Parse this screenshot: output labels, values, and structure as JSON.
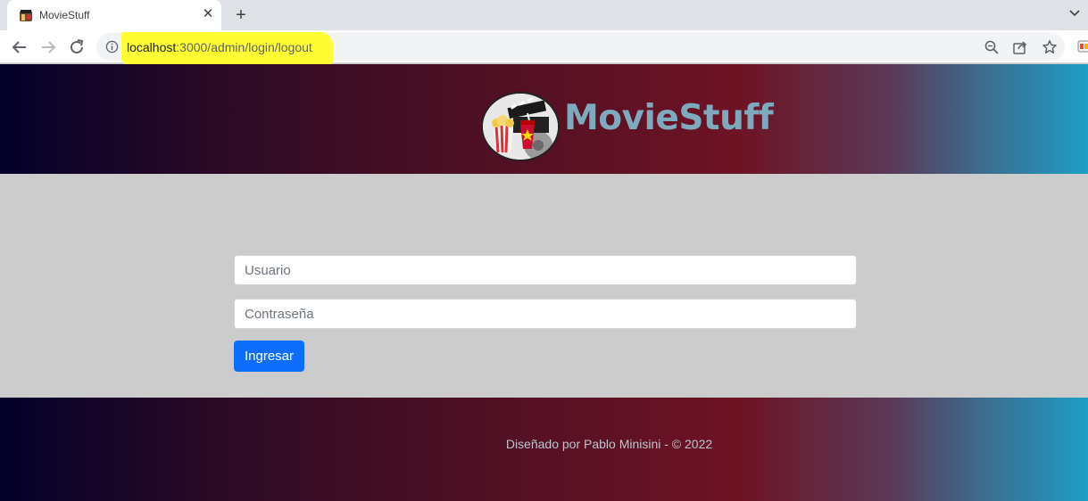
{
  "browser": {
    "tab": {
      "title": "MovieStuff",
      "close": "✕"
    },
    "new_tab": "+",
    "address": {
      "host": "localhost",
      "path": ":3000/admin/login/logout"
    }
  },
  "header": {
    "brand": "MovieStuff"
  },
  "login": {
    "username_placeholder": "Usuario",
    "password_placeholder": "Contraseña",
    "submit_label": "Ingresar"
  },
  "footer": {
    "credit": "Diseñado por Pablo Minisini - © 2022"
  },
  "colors": {
    "primary_button": "#0d6efd",
    "brand_text": "#7fa9bc",
    "page_bg": "#cccccc",
    "url_highlight": "#ffff33"
  }
}
